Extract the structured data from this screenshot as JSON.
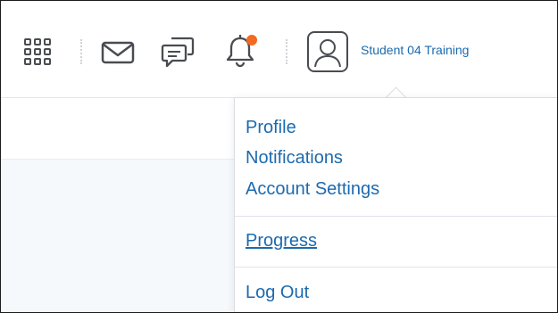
{
  "header": {
    "icons": {
      "apps": "grid-icon",
      "mail": "envelope-icon",
      "messages": "chat-bubbles-icon",
      "notifications": "bell-icon",
      "avatar": "user-avatar-icon"
    },
    "notification_dot_color": "#f26a21",
    "username": "Student 04 Training"
  },
  "menu": {
    "items": [
      {
        "label": "Profile"
      },
      {
        "label": "Notifications"
      },
      {
        "label": "Account Settings"
      },
      {
        "label": "Progress"
      },
      {
        "label": "Log Out"
      }
    ]
  },
  "colors": {
    "link": "#1c6aaf",
    "icon": "#494c50",
    "divider": "#dfe3e8"
  }
}
